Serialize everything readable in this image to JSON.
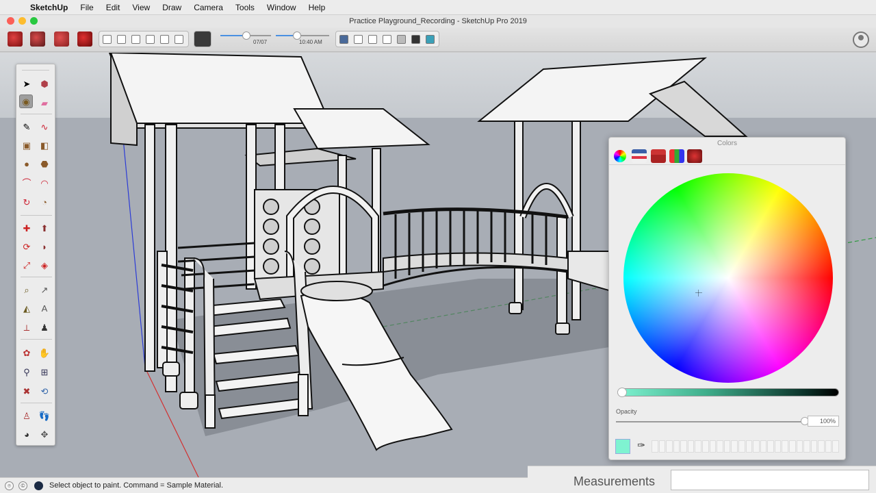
{
  "menubar": {
    "app": "SketchUp",
    "items": [
      "File",
      "Edit",
      "View",
      "Draw",
      "Camera",
      "Tools",
      "Window",
      "Help"
    ]
  },
  "window": {
    "title": "Practice Playground_Recording - SketchUp Pro 2019"
  },
  "toolbar": {
    "shadow_date": "07/07",
    "shadow_time": "10:40 AM"
  },
  "colors_panel": {
    "title": "Colors",
    "tabs": [
      "color-wheel",
      "color-sliders",
      "color-palettes",
      "image-palettes",
      "crayons"
    ],
    "active_tab": "color-wheel",
    "opacity_label": "Opacity",
    "opacity_value": "100%",
    "current_color": "#7ff3d1"
  },
  "measurements": {
    "label": "Measurements",
    "value": ""
  },
  "statusbar": {
    "text": "Select object to paint. Command = Sample Material."
  },
  "tools": [
    "select",
    "make-component",
    "paint-bucket",
    "eraser",
    "line",
    "freehand",
    "rectangle",
    "rotated-rectangle",
    "circle",
    "polygon",
    "arc",
    "pie",
    "move",
    "push-pull",
    "rotate",
    "follow-me",
    "scale",
    "offset",
    "tape-measure",
    "dimension",
    "protractor",
    "text",
    "axes",
    "3d-text",
    "orbit",
    "pan",
    "zoom",
    "zoom-window",
    "zoom-extents",
    "previous",
    "position-camera",
    "walk",
    "look-around",
    "section-plane"
  ]
}
